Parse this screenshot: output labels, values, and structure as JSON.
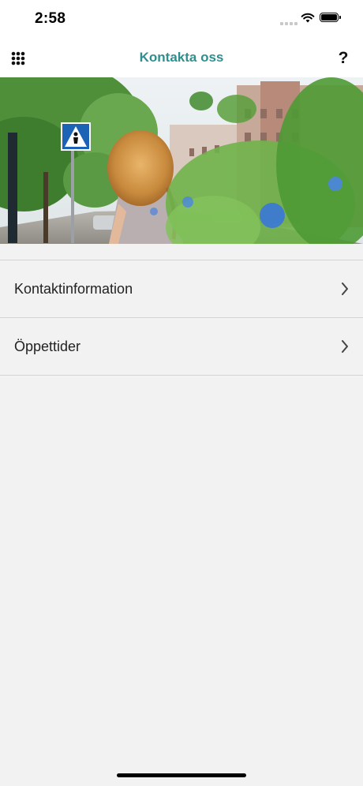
{
  "status": {
    "time": "2:58",
    "signal_icon": "cellular-signal-icon",
    "wifi_icon": "wifi-icon",
    "battery_icon": "battery-icon"
  },
  "navbar": {
    "title": "Kontakta oss",
    "menu_icon": "grid-menu-icon",
    "help_label": "?",
    "title_color": "#2f8f8f"
  },
  "hero": {
    "image": "street-scene-photo"
  },
  "list": {
    "items": [
      {
        "label": "Kontaktinformation",
        "icon": "chevron-right-icon"
      },
      {
        "label": "Öppettider",
        "icon": "chevron-right-icon"
      }
    ]
  },
  "colors": {
    "background": "#f2f2f2",
    "separator": "#d4d4d4",
    "accent": "#2f8f8f"
  }
}
